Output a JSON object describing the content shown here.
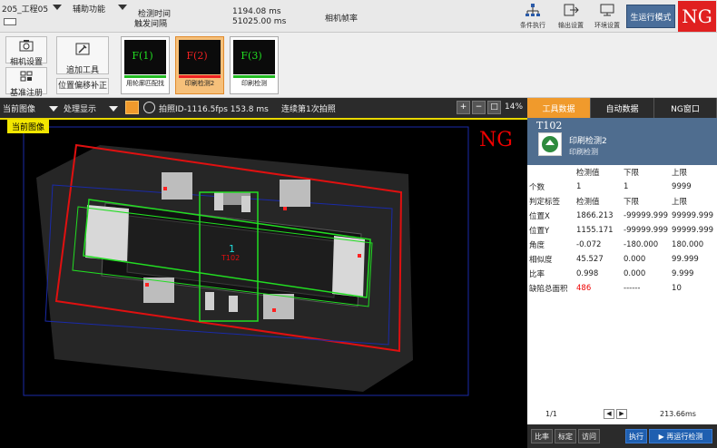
{
  "topbar": {
    "project": "205_工程05",
    "assist_menu": "辅助功能",
    "detect_time_label": "检测时间",
    "trigger_interval_label": "触发间隔",
    "detect_time_value": "1194.08 ms",
    "trigger_interval_value": "51025.00 ms",
    "camera_frame_rate": "相机帧率",
    "btn_execute": "条件执行",
    "btn_output": "输出设置",
    "btn_env": "环境设置",
    "mode_button": "生运行模式",
    "status": "NG"
  },
  "toolstrip": {
    "camera_settings": "相机设置",
    "baseline_register": "基准注册",
    "add_tool": "追加工具",
    "position_offset": "位置偏移补正",
    "thumbnails": [
      {
        "label": "F(1)",
        "caption": "用轮廓匹配找",
        "label_color": "#22dd22",
        "bar_color": "#22bb22"
      },
      {
        "label": "F(2)",
        "caption": "印刷检测2",
        "label_color": "#ee2222",
        "bar_color": "#ee2222"
      },
      {
        "label": "F(3)",
        "caption": "印刷检测",
        "label_color": "#22dd22",
        "bar_color": "#22bb22"
      }
    ]
  },
  "imgbar": {
    "current_image": "当前图像",
    "process_display": "处理显示",
    "capture_info": "拍照ID-1116.5fps 153.8 ms",
    "continuous": "连续第1次拍照",
    "zoom": "14%"
  },
  "viewer": {
    "tag": "当前图像",
    "ng_label": "NG",
    "tool_number": "1",
    "tool_value": "T102"
  },
  "rpanel": {
    "tabs": [
      "工具数据",
      "自动数据",
      "NG窗口"
    ],
    "tool_id": "T102",
    "tool_name": "印刷检测2",
    "tool_sub": "印刷检测",
    "headers": [
      "",
      "检测值",
      "下限",
      "上限"
    ],
    "rows": [
      [
        "个数",
        "1",
        "1",
        "9999"
      ],
      [
        "判定标签",
        "检测值",
        "下限",
        "上限"
      ],
      [
        "位置X",
        "1866.213",
        "-99999.999",
        "99999.999"
      ],
      [
        "位置Y",
        "1155.171",
        "-99999.999",
        "99999.999"
      ],
      [
        "角度",
        "-0.072",
        "-180.000",
        "180.000"
      ],
      [
        "相似度",
        "45.527",
        "0.000",
        "99.999"
      ],
      [
        "比率",
        "0.998",
        "0.000",
        "9.999"
      ],
      [
        "缺陷总面积",
        "486",
        "------",
        "10"
      ]
    ],
    "page": "1/1",
    "time": "213.66ms",
    "foot_btn1": "比率",
    "foot_btn2": "标定",
    "foot_btn3": "访问",
    "exec_btn": "执行",
    "rerun_btn": "▶ 再运行检测"
  },
  "colors": {
    "accent_orange": "#f09a2c",
    "ng_red": "#e02020",
    "roi_green": "#22dd22",
    "roi_red": "#e01010"
  }
}
